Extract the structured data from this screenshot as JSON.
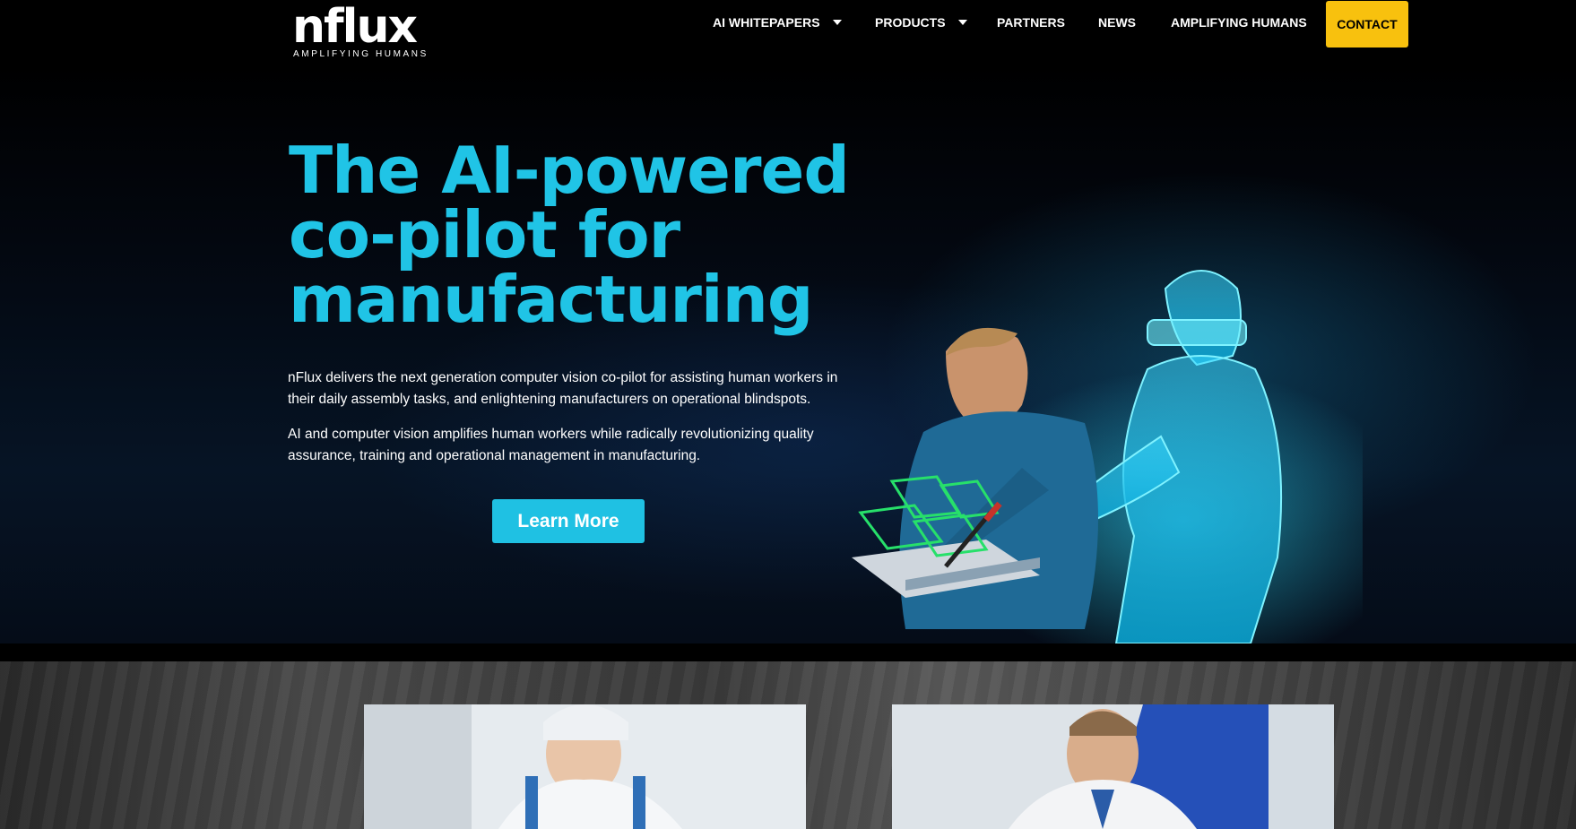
{
  "header": {
    "logo": {
      "word": "nflux",
      "tagline": "AMPLIFYING HUMANS"
    },
    "nav": [
      {
        "label": "AI WHITEPAPERS",
        "has_dropdown": true
      },
      {
        "label": "PRODUCTS",
        "has_dropdown": true
      },
      {
        "label": "PARTNERS",
        "has_dropdown": false
      },
      {
        "label": "NEWS",
        "has_dropdown": false
      },
      {
        "label": "AMPLIFYING HUMANS",
        "has_dropdown": false
      }
    ],
    "contact_label": "CONTACT"
  },
  "hero": {
    "title": "The AI-powered co-pilot for manufacturing",
    "paragraph_1": "nFlux delivers the next generation computer vision co-pilot for assisting human workers in their daily assembly tasks, and enlightening manufacturers on operational blindspots.",
    "paragraph_2": "AI and computer vision amplifies human workers while radically revolutionizing quality assurance, training and operational management in manufacturing.",
    "cta_label": "Learn More"
  },
  "colors": {
    "accent": "#20c4e6",
    "contact_button": "#f8c10e",
    "background": "#000000"
  }
}
